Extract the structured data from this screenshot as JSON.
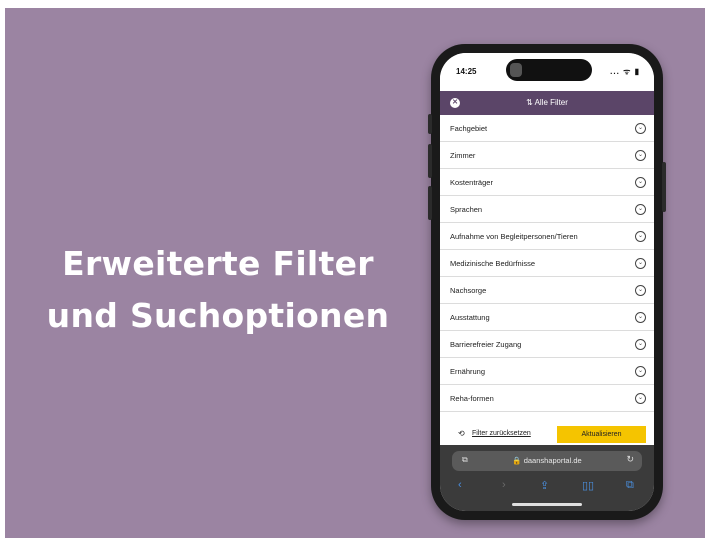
{
  "headline": {
    "line1": "Erweiterte Filter",
    "line2": "und Suchoptionen"
  },
  "status_bar": {
    "time": "14:25",
    "icons": "... ᯤ ▮"
  },
  "app_bar": {
    "close_icon": "✕",
    "title": "⇅ Alle Filter"
  },
  "filters": [
    {
      "label": "Fachgebiet"
    },
    {
      "label": "Zimmer"
    },
    {
      "label": "Kostenträger"
    },
    {
      "label": "Sprachen"
    },
    {
      "label": "Aufnahme von Begleitpersonen/Tieren"
    },
    {
      "label": "Medizinische Bedürfnisse"
    },
    {
      "label": "Nachsorge"
    },
    {
      "label": "Ausstattung"
    },
    {
      "label": "Barrierefreier Zugang"
    },
    {
      "label": "Ernährung"
    },
    {
      "label": "Reha-formen"
    }
  ],
  "chevron_glyph": "⌄",
  "actions": {
    "reset_icon": "⟲",
    "reset_label": "Filter zurücksetzen",
    "update_label": "Aktualisieren"
  },
  "browser": {
    "tab_icon": "⧉",
    "address": "🔒 daanshaportal.de",
    "reload_icon": "↻",
    "back": "‹",
    "forward": "›",
    "share": "⇪",
    "bookmarks": "▯▯",
    "tabs": "⧉"
  },
  "colors": {
    "background": "#9b84a2",
    "app_bar": "#5b4568",
    "update_button": "#f5c400",
    "browser_accent": "#4a90e2"
  }
}
